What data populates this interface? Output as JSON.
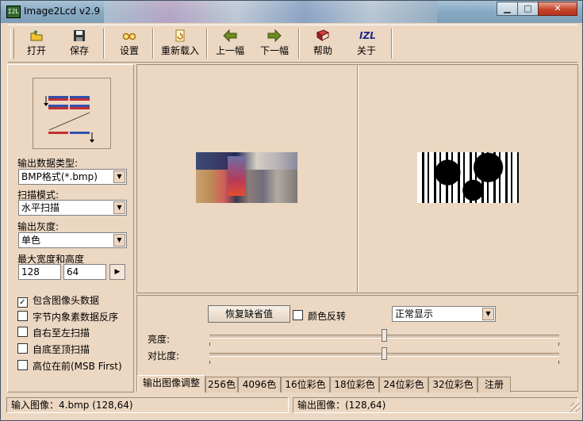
{
  "window": {
    "title": "Image2Lcd v2.9",
    "app_icon_text": "I2L",
    "minimize": "▁",
    "maximize": "□",
    "close": "✕"
  },
  "toolbar": {
    "items": [
      {
        "label": "打开",
        "icon": "open-folder-icon"
      },
      {
        "label": "保存",
        "icon": "save-floppy-icon"
      },
      {
        "label": "设置",
        "icon": "settings-glasses-icon"
      },
      {
        "label": "重新载入",
        "icon": "reload-icon"
      },
      {
        "label": "上一幅",
        "icon": "left-arrow-icon"
      },
      {
        "label": "下一幅",
        "icon": "right-arrow-icon"
      },
      {
        "label": "帮助",
        "icon": "help-book-icon"
      },
      {
        "label": "关于",
        "icon": "about-logo-icon",
        "logo_text": "IZL"
      }
    ]
  },
  "settings": {
    "output_type_label": "输出数据类型:",
    "output_type_value": "BMP格式(*.bmp)",
    "scan_mode_label": "扫描模式:",
    "scan_mode_value": "水平扫描",
    "gray_label": "输出灰度:",
    "gray_value": "单色",
    "size_label": "最大宽度和高度",
    "max_width": "128",
    "max_height": "64",
    "spin_glyph": "▶",
    "combo_arrow": "▼",
    "checkboxes": [
      {
        "label": "包含图像头数据",
        "checked": true,
        "mark": "✓"
      },
      {
        "label": "字节内象素数据反序",
        "checked": false,
        "mark": ""
      },
      {
        "label": "自右至左扫描",
        "checked": false,
        "mark": ""
      },
      {
        "label": "自底至顶扫描",
        "checked": false,
        "mark": ""
      },
      {
        "label": "高位在前(MSB First)",
        "checked": false,
        "mark": ""
      }
    ]
  },
  "adjust": {
    "restore_button": "恢复缺省值",
    "invert_label": "颜色反转",
    "display_mode": "正常显示",
    "brightness_label": "亮度:",
    "contrast_label": "对比度:",
    "brightness_value": 0.5,
    "contrast_value": 0.5
  },
  "tabs": [
    "输出图像调整",
    "256色",
    "4096色",
    "16位彩色",
    "18位彩色",
    "24位彩色",
    "32位彩色",
    "注册"
  ],
  "status": {
    "input": "输入图像：4.bmp (128,64)",
    "output": "输出图像：(128,64)"
  }
}
